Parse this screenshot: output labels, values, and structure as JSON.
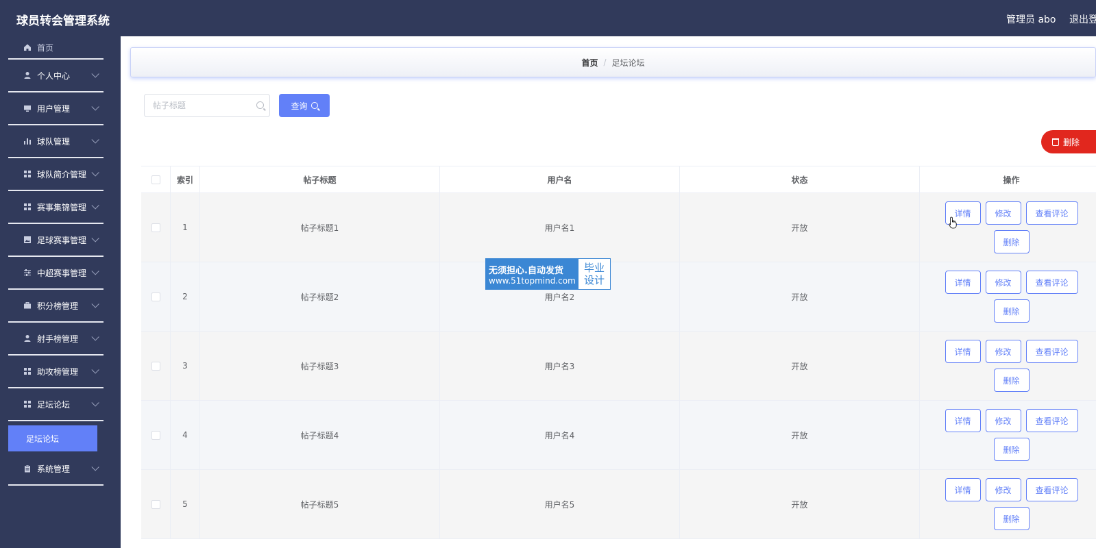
{
  "app": {
    "title": "球员转会管理系统"
  },
  "header": {
    "user": "管理员 abo",
    "logout": "退出登录"
  },
  "sidebar": {
    "home": "首页",
    "items": [
      {
        "label": "个人中心",
        "icon": "user-icon"
      },
      {
        "label": "用户管理",
        "icon": "monitor-icon"
      },
      {
        "label": "球队管理",
        "icon": "bar-chart-icon"
      },
      {
        "label": "球队简介管理",
        "icon": "grid-icon"
      },
      {
        "label": "赛事集锦管理",
        "icon": "grid-icon"
      },
      {
        "label": "足球赛事管理",
        "icon": "image-icon"
      },
      {
        "label": "中超赛事管理",
        "icon": "sliders-icon"
      },
      {
        "label": "积分榜管理",
        "icon": "briefcase-icon"
      },
      {
        "label": "射手榜管理",
        "icon": "user-icon"
      },
      {
        "label": "助攻榜管理",
        "icon": "grid-icon"
      },
      {
        "label": "足坛论坛",
        "icon": "grid-icon"
      },
      {
        "label": "系统管理",
        "icon": "clipboard-icon"
      }
    ],
    "active_sub": "足坛论坛"
  },
  "breadcrumb": {
    "home": "首页",
    "sep": "/",
    "current": "足坛论坛"
  },
  "search": {
    "placeholder": "帖子标题",
    "button": "查询"
  },
  "toolbar": {
    "delete": "删除"
  },
  "table": {
    "headers": [
      "索引",
      "帖子标题",
      "用户名",
      "状态",
      "操作"
    ],
    "rows": [
      {
        "index": "1",
        "title": "帖子标题1",
        "user": "用户名1",
        "status": "开放"
      },
      {
        "index": "2",
        "title": "帖子标题2",
        "user": "用户名2",
        "status": "开放"
      },
      {
        "index": "3",
        "title": "帖子标题3",
        "user": "用户名3",
        "status": "开放"
      },
      {
        "index": "4",
        "title": "帖子标题4",
        "user": "用户名4",
        "status": "开放"
      },
      {
        "index": "5",
        "title": "帖子标题5",
        "user": "用户名5",
        "status": "开放"
      }
    ],
    "actions": {
      "detail": "详情",
      "edit": "修改",
      "comments": "查看评论",
      "delete": "删除"
    }
  },
  "watermark": {
    "line1": "无须担心.自动发货",
    "line2": "www.51topmind.com",
    "right1": "毕业",
    "right2": "设计"
  },
  "colors": {
    "sidebar": "#313a5b",
    "accent": "#6280f8",
    "danger": "#e1271e"
  }
}
